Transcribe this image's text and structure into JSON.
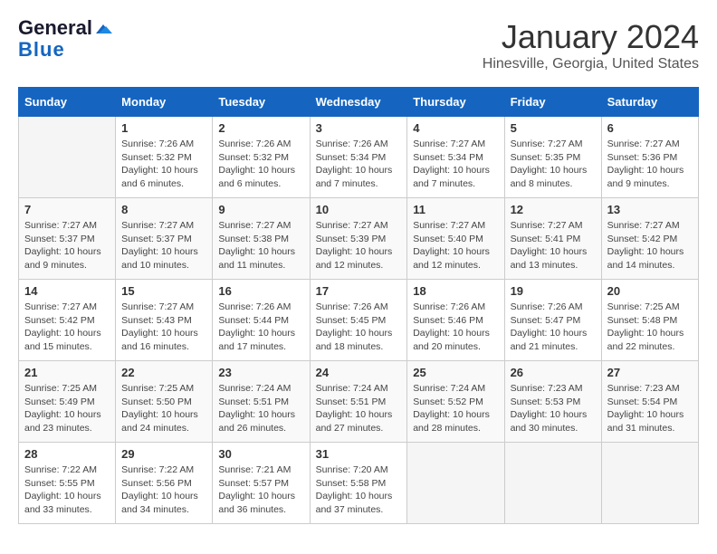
{
  "app": {
    "logo_general": "General",
    "logo_blue": "Blue",
    "title": "January 2024",
    "subtitle": "Hinesville, Georgia, United States"
  },
  "calendar": {
    "headers": [
      "Sunday",
      "Monday",
      "Tuesday",
      "Wednesday",
      "Thursday",
      "Friday",
      "Saturday"
    ],
    "weeks": [
      [
        {
          "num": "",
          "info": ""
        },
        {
          "num": "1",
          "info": "Sunrise: 7:26 AM\nSunset: 5:32 PM\nDaylight: 10 hours\nand 6 minutes."
        },
        {
          "num": "2",
          "info": "Sunrise: 7:26 AM\nSunset: 5:32 PM\nDaylight: 10 hours\nand 6 minutes."
        },
        {
          "num": "3",
          "info": "Sunrise: 7:26 AM\nSunset: 5:34 PM\nDaylight: 10 hours\nand 7 minutes."
        },
        {
          "num": "4",
          "info": "Sunrise: 7:27 AM\nSunset: 5:34 PM\nDaylight: 10 hours\nand 7 minutes."
        },
        {
          "num": "5",
          "info": "Sunrise: 7:27 AM\nSunset: 5:35 PM\nDaylight: 10 hours\nand 8 minutes."
        },
        {
          "num": "6",
          "info": "Sunrise: 7:27 AM\nSunset: 5:36 PM\nDaylight: 10 hours\nand 9 minutes."
        }
      ],
      [
        {
          "num": "7",
          "info": "Sunrise: 7:27 AM\nSunset: 5:37 PM\nDaylight: 10 hours\nand 9 minutes."
        },
        {
          "num": "8",
          "info": "Sunrise: 7:27 AM\nSunset: 5:37 PM\nDaylight: 10 hours\nand 10 minutes."
        },
        {
          "num": "9",
          "info": "Sunrise: 7:27 AM\nSunset: 5:38 PM\nDaylight: 10 hours\nand 11 minutes."
        },
        {
          "num": "10",
          "info": "Sunrise: 7:27 AM\nSunset: 5:39 PM\nDaylight: 10 hours\nand 12 minutes."
        },
        {
          "num": "11",
          "info": "Sunrise: 7:27 AM\nSunset: 5:40 PM\nDaylight: 10 hours\nand 12 minutes."
        },
        {
          "num": "12",
          "info": "Sunrise: 7:27 AM\nSunset: 5:41 PM\nDaylight: 10 hours\nand 13 minutes."
        },
        {
          "num": "13",
          "info": "Sunrise: 7:27 AM\nSunset: 5:42 PM\nDaylight: 10 hours\nand 14 minutes."
        }
      ],
      [
        {
          "num": "14",
          "info": "Sunrise: 7:27 AM\nSunset: 5:42 PM\nDaylight: 10 hours\nand 15 minutes."
        },
        {
          "num": "15",
          "info": "Sunrise: 7:27 AM\nSunset: 5:43 PM\nDaylight: 10 hours\nand 16 minutes."
        },
        {
          "num": "16",
          "info": "Sunrise: 7:26 AM\nSunset: 5:44 PM\nDaylight: 10 hours\nand 17 minutes."
        },
        {
          "num": "17",
          "info": "Sunrise: 7:26 AM\nSunset: 5:45 PM\nDaylight: 10 hours\nand 18 minutes."
        },
        {
          "num": "18",
          "info": "Sunrise: 7:26 AM\nSunset: 5:46 PM\nDaylight: 10 hours\nand 20 minutes."
        },
        {
          "num": "19",
          "info": "Sunrise: 7:26 AM\nSunset: 5:47 PM\nDaylight: 10 hours\nand 21 minutes."
        },
        {
          "num": "20",
          "info": "Sunrise: 7:25 AM\nSunset: 5:48 PM\nDaylight: 10 hours\nand 22 minutes."
        }
      ],
      [
        {
          "num": "21",
          "info": "Sunrise: 7:25 AM\nSunset: 5:49 PM\nDaylight: 10 hours\nand 23 minutes."
        },
        {
          "num": "22",
          "info": "Sunrise: 7:25 AM\nSunset: 5:50 PM\nDaylight: 10 hours\nand 24 minutes."
        },
        {
          "num": "23",
          "info": "Sunrise: 7:24 AM\nSunset: 5:51 PM\nDaylight: 10 hours\nand 26 minutes."
        },
        {
          "num": "24",
          "info": "Sunrise: 7:24 AM\nSunset: 5:51 PM\nDaylight: 10 hours\nand 27 minutes."
        },
        {
          "num": "25",
          "info": "Sunrise: 7:24 AM\nSunset: 5:52 PM\nDaylight: 10 hours\nand 28 minutes."
        },
        {
          "num": "26",
          "info": "Sunrise: 7:23 AM\nSunset: 5:53 PM\nDaylight: 10 hours\nand 30 minutes."
        },
        {
          "num": "27",
          "info": "Sunrise: 7:23 AM\nSunset: 5:54 PM\nDaylight: 10 hours\nand 31 minutes."
        }
      ],
      [
        {
          "num": "28",
          "info": "Sunrise: 7:22 AM\nSunset: 5:55 PM\nDaylight: 10 hours\nand 33 minutes."
        },
        {
          "num": "29",
          "info": "Sunrise: 7:22 AM\nSunset: 5:56 PM\nDaylight: 10 hours\nand 34 minutes."
        },
        {
          "num": "30",
          "info": "Sunrise: 7:21 AM\nSunset: 5:57 PM\nDaylight: 10 hours\nand 36 minutes."
        },
        {
          "num": "31",
          "info": "Sunrise: 7:20 AM\nSunset: 5:58 PM\nDaylight: 10 hours\nand 37 minutes."
        },
        {
          "num": "",
          "info": ""
        },
        {
          "num": "",
          "info": ""
        },
        {
          "num": "",
          "info": ""
        }
      ]
    ]
  }
}
